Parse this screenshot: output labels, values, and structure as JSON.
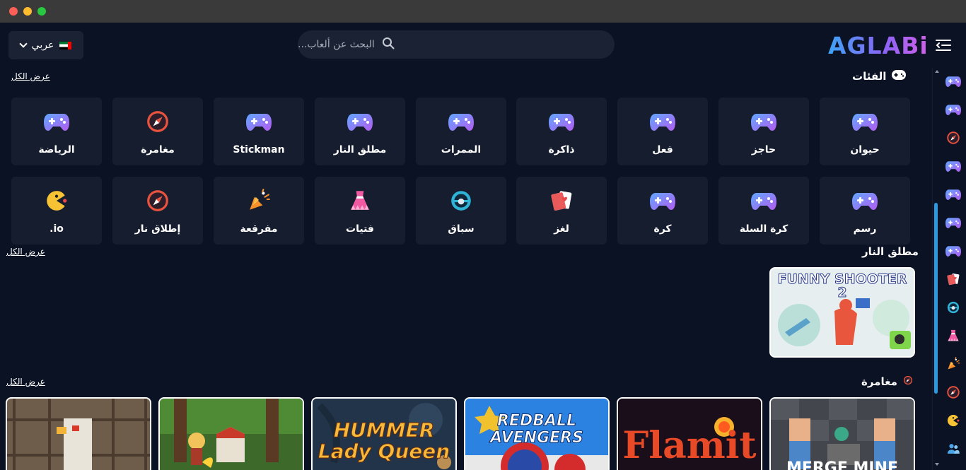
{
  "header": {
    "language_label": "عربي",
    "search_placeholder": "البحث عن ألعاب...",
    "logo_text": "AGLABi"
  },
  "categories_section": {
    "title": "الفئات",
    "view_all": "عرض الكل",
    "items": [
      {
        "label": "حيوان",
        "icon": "gamepad-icon"
      },
      {
        "label": "حاجز",
        "icon": "gamepad-icon"
      },
      {
        "label": "فعل",
        "icon": "gamepad-icon"
      },
      {
        "label": "ذاكرة",
        "icon": "gamepad-icon"
      },
      {
        "label": "الممرات",
        "icon": "gamepad-icon"
      },
      {
        "label": "مطلق النار",
        "icon": "gamepad-icon"
      },
      {
        "label": "Stickman",
        "icon": "gamepad-icon"
      },
      {
        "label": "مغامرة",
        "icon": "compass-icon"
      },
      {
        "label": "الرياضة",
        "icon": "gamepad-icon"
      },
      {
        "label": "رسم",
        "icon": "gamepad-icon"
      },
      {
        "label": "كرة السلة",
        "icon": "gamepad-icon"
      },
      {
        "label": "كرة",
        "icon": "gamepad-icon"
      },
      {
        "label": "لغز",
        "icon": "cards-icon"
      },
      {
        "label": "سباق",
        "icon": "steering-wheel-icon"
      },
      {
        "label": "فتيات",
        "icon": "dress-icon"
      },
      {
        "label": "مفرقعة",
        "icon": "party-popper-icon"
      },
      {
        "label": "إطلاق نار",
        "icon": "compass-icon"
      },
      {
        "label": "io.",
        "icon": "pacman-icon"
      }
    ]
  },
  "shooter_section": {
    "title": "مطلق النار",
    "view_all": "عرض الكل",
    "games": [
      {
        "title": "FUNNY SHOOTER 2"
      }
    ]
  },
  "adventure_section": {
    "title": "مغامرة",
    "view_all": "عرض الكل",
    "games": [
      {
        "title": "MERGE MINE"
      },
      {
        "title": "Flamit"
      },
      {
        "title": "REDBALL AVENGERS"
      },
      {
        "title": "HUMMER Lady Queen"
      },
      {
        "title": ""
      },
      {
        "title": ""
      }
    ]
  },
  "sidebar": {
    "icons": [
      "gamepad-icon",
      "gamepad-icon",
      "compass-icon",
      "gamepad-icon",
      "gamepad-icon",
      "gamepad-icon",
      "gamepad-icon",
      "cards-icon",
      "steering-wheel-icon",
      "dress-icon",
      "party-popper-icon",
      "compass-icon",
      "pacman-icon",
      "users-icon"
    ]
  },
  "colors": {
    "background": "#0b1224",
    "card": "#161d2f",
    "accent_blue": "#2d97e0",
    "accent_purple": "#8c63f5"
  }
}
